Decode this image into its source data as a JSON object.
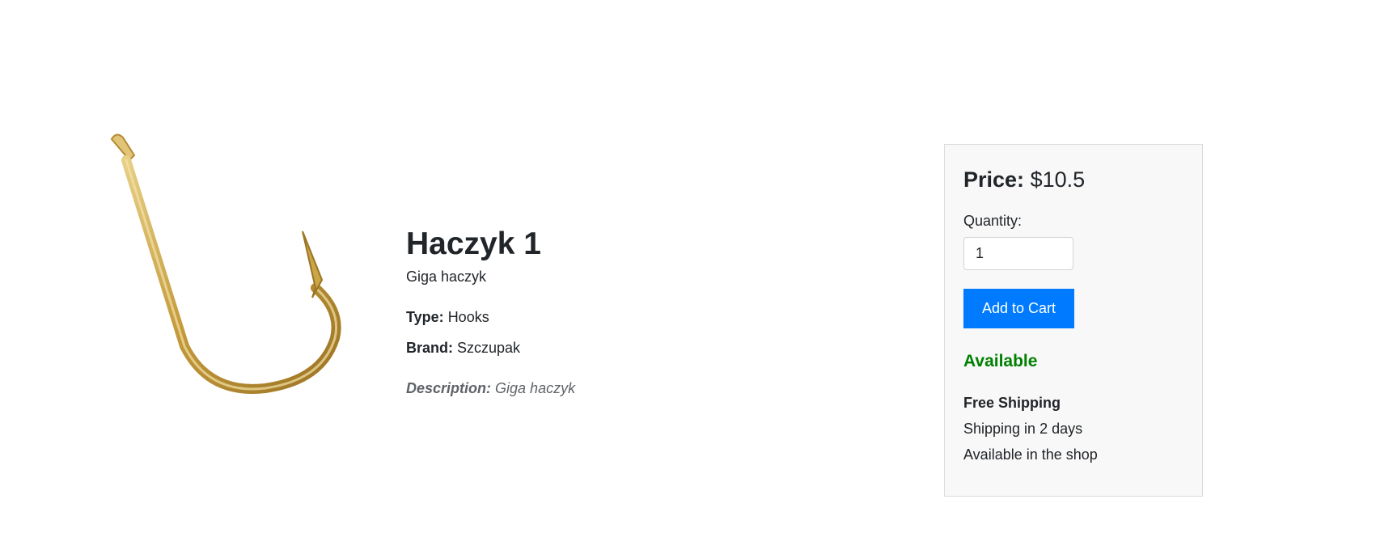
{
  "product": {
    "title": "Haczyk 1",
    "subtitle": "Giga haczyk",
    "type_label": "Type:",
    "type_value": "Hooks",
    "brand_label": "Brand:",
    "brand_value": "Szczupak",
    "description_label": "Description:",
    "description_value": "Giga haczyk",
    "image_icon": "fishing-hook-image"
  },
  "purchase": {
    "price_label": "Price:",
    "price_value": "$10.5",
    "quantity_label": "Quantity:",
    "quantity_value": "1",
    "add_to_cart_label": "Add to Cart",
    "availability": "Available",
    "shipping_title": "Free Shipping",
    "shipping_time": "Shipping in 2 days",
    "shop_availability": "Available in the shop"
  },
  "colors": {
    "primary_button": "#007bff",
    "available": "#008000",
    "box_background": "#f8f8f8",
    "hook_gold": "#c9a646"
  }
}
